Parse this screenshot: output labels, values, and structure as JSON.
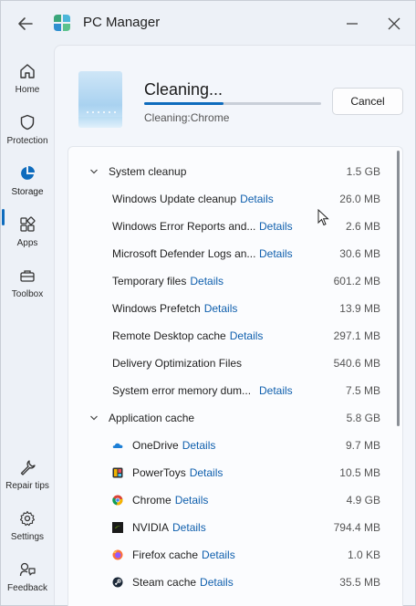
{
  "app": {
    "title": "PC Manager"
  },
  "sidebar": {
    "items": [
      {
        "label": "Home",
        "icon": "home-icon"
      },
      {
        "label": "Protection",
        "icon": "shield-icon"
      },
      {
        "label": "Storage",
        "icon": "pie-chart-icon",
        "active": true
      },
      {
        "label": "Apps",
        "icon": "apps-grid-icon"
      },
      {
        "label": "Toolbox",
        "icon": "toolbox-icon"
      },
      {
        "label": "Repair tips",
        "icon": "wrench-icon"
      },
      {
        "label": "Settings",
        "icon": "gear-icon"
      },
      {
        "label": "Feedback",
        "icon": "feedback-icon"
      }
    ]
  },
  "cleaning": {
    "title": "Cleaning...",
    "subtitle": "Cleaning:Chrome",
    "progress": 0.45,
    "cancel_label": "Cancel"
  },
  "groups": [
    {
      "label": "System cleanup",
      "size": "1.5 GB",
      "items": [
        {
          "label": "Windows Update cleanup",
          "details": "Details",
          "size": "26.0 MB"
        },
        {
          "label": "Windows Error Reports and...",
          "details": "Details",
          "size": "2.6 MB"
        },
        {
          "label": "Microsoft Defender Logs an...",
          "details": "Details",
          "size": "30.6 MB"
        },
        {
          "label": "Temporary files",
          "details": "Details",
          "size": "601.2 MB"
        },
        {
          "label": "Windows Prefetch",
          "details": "Details",
          "size": "13.9 MB"
        },
        {
          "label": "Remote Desktop cache",
          "details": "Details",
          "size": "297.1 MB"
        },
        {
          "label": "Delivery Optimization Files",
          "details": "",
          "size": "540.6 MB"
        },
        {
          "label": "System error memory dum...",
          "details": "Details",
          "size": "7.5 MB"
        }
      ]
    },
    {
      "label": "Application cache",
      "size": "5.8 GB",
      "items": [
        {
          "label": "OneDrive",
          "details": "Details",
          "size": "9.7 MB",
          "icon": "onedrive-icon"
        },
        {
          "label": "PowerToys",
          "details": "Details",
          "size": "10.5 MB",
          "icon": "powertoys-icon"
        },
        {
          "label": "Chrome",
          "details": "Details",
          "size": "4.9 GB",
          "icon": "chrome-icon"
        },
        {
          "label": "NVIDIA",
          "details": "Details",
          "size": "794.4 MB",
          "icon": "nvidia-icon"
        },
        {
          "label": "Firefox cache",
          "details": "Details",
          "size": "1.0 KB",
          "icon": "firefox-icon"
        },
        {
          "label": "Steam cache",
          "details": "Details",
          "size": "35.5 MB",
          "icon": "steam-icon"
        }
      ]
    }
  ],
  "colors": {
    "accent": "#0f6cbd",
    "link": "#0f5fad"
  }
}
